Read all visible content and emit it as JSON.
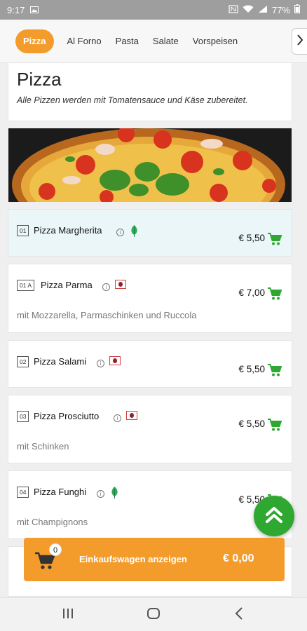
{
  "status_bar": {
    "time": "9:17",
    "battery": "77%"
  },
  "tabs": [
    {
      "label": "Pizza",
      "active": true
    },
    {
      "label": "Al Forno"
    },
    {
      "label": "Pasta"
    },
    {
      "label": "Salate"
    },
    {
      "label": "Vorspeisen"
    }
  ],
  "section": {
    "title": "Pizza",
    "description": "Alle Pizzen werden mit Tomatensauce und Käse zubereitet."
  },
  "items": [
    {
      "number": "01",
      "name": "Pizza Margherita",
      "price": "€ 5,50",
      "description": "",
      "badge": "vegetarian"
    },
    {
      "number": "01 A",
      "name": "Pizza Parma",
      "price": "€ 7,00",
      "description": "mit Mozzarella, Parmaschinken und Ruccola",
      "badge": "meat"
    },
    {
      "number": "02",
      "name": "Pizza Salami",
      "price": "€ 5,50",
      "description": "",
      "badge": "meat"
    },
    {
      "number": "03",
      "name": "Pizza Prosciutto",
      "price": "€ 5,50",
      "description": "mit Schinken",
      "badge": "meat"
    },
    {
      "number": "04",
      "name": "Pizza Funghi",
      "price": "€ 5,50",
      "description": "mit Champignons",
      "badge": "vegetarian"
    }
  ],
  "cart": {
    "count": "0",
    "label": "Einkaufswagen anzeigen",
    "total": "€ 0,00"
  },
  "colors": {
    "accent": "#f39c2c",
    "green": "#2ea830",
    "highlight": "#eaf6f8"
  },
  "icons": {
    "info": "info-icon",
    "cart": "cart-icon",
    "scroll_top": "double-chevron-up-icon"
  }
}
